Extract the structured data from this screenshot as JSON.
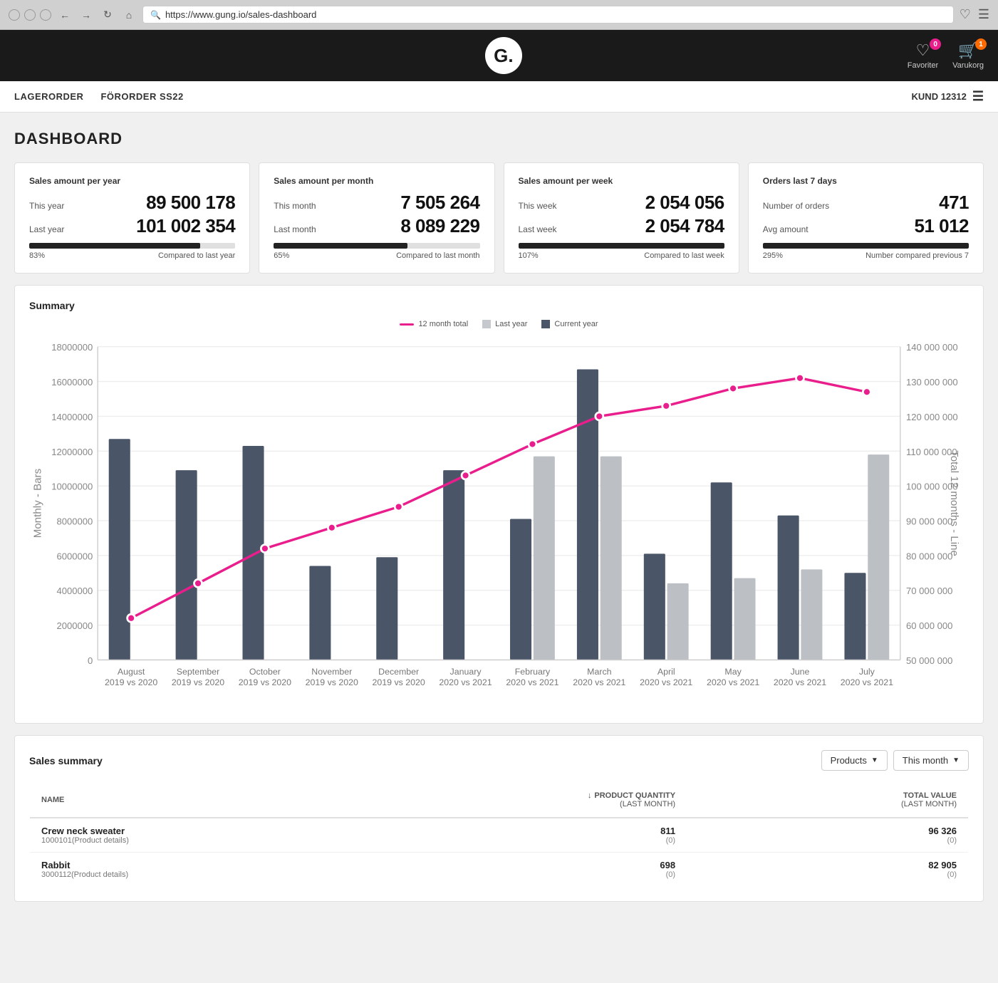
{
  "browser": {
    "url": "https://www.gung.io/sales-dashboard",
    "search_placeholder": "Search"
  },
  "header": {
    "logo_text": "G.",
    "favorites_label": "Favoriter",
    "cart_label": "Varukorg",
    "favorites_badge": "0",
    "cart_badge": "1"
  },
  "nav": {
    "items": [
      {
        "id": "lagerorder",
        "label": "LAGERORDER"
      },
      {
        "id": "fororder",
        "label": "FÖRORDER SS22"
      }
    ],
    "customer": "KUND 12312"
  },
  "page": {
    "title": "DASHBOARD"
  },
  "kpi_cards": [
    {
      "title": "Sales amount per year",
      "row1_label": "This year",
      "row1_value": "89 500 178",
      "row2_label": "Last year",
      "row2_value": "101 002 354",
      "bar_pct": 83,
      "footer_left": "83%",
      "footer_right": "Compared to last year"
    },
    {
      "title": "Sales amount per month",
      "row1_label": "This month",
      "row1_value": "7 505 264",
      "row2_label": "Last month",
      "row2_value": "8 089 229",
      "bar_pct": 65,
      "footer_left": "65%",
      "footer_right": "Compared to last month"
    },
    {
      "title": "Sales amount per week",
      "row1_label": "This week",
      "row1_value": "2 054 056",
      "row2_label": "Last week",
      "row2_value": "2 054 784",
      "bar_pct": 107,
      "footer_left": "107%",
      "footer_right": "Compared to last week"
    },
    {
      "title": "Orders last 7 days",
      "row1_label": "Number of orders",
      "row1_value": "471",
      "row2_label": "Avg amount",
      "row2_value": "51 012",
      "bar_pct": 100,
      "footer_left": "295%",
      "footer_right": "Number compared previous 7"
    }
  ],
  "chart": {
    "title": "Summary",
    "legend": {
      "line_label": "12 month total",
      "bar_light_label": "Last year",
      "bar_dark_label": "Current year"
    },
    "y_left_label": "Monthly - Bars",
    "y_right_label": "Total 12 months - Line",
    "y_left_ticks": [
      "18000000",
      "16000000",
      "14000000",
      "12000000",
      "10000000",
      "8000000",
      "6000000",
      "4000000",
      "2000000",
      "0"
    ],
    "y_right_ticks": [
      "140000000",
      "130000000",
      "120000000",
      "110000000",
      "100000000",
      "90000000",
      "80000000",
      "70000000",
      "60000000",
      "50000000"
    ],
    "months": [
      {
        "label": "August\n2019 vs 2020",
        "dark": 12700000,
        "light": 0,
        "line": 62000000
      },
      {
        "label": "September\n2019 vs 2020",
        "dark": 10900000,
        "light": 0,
        "line": 72000000
      },
      {
        "label": "October\n2019 vs 2020",
        "dark": 12300000,
        "light": 0,
        "line": 82000000
      },
      {
        "label": "November\n2019 vs 2020",
        "dark": 5400000,
        "light": 0,
        "line": 88000000
      },
      {
        "label": "December\n2019 vs 2020",
        "dark": 5900000,
        "light": 0,
        "line": 94000000
      },
      {
        "label": "January\n2020 vs 2021",
        "dark": 10900000,
        "light": 0,
        "line": 103000000
      },
      {
        "label": "February\n2020 vs 2021",
        "dark": 8100000,
        "light": 11700000,
        "line": 112000000
      },
      {
        "label": "March\n2020 vs 2021",
        "dark": 16700000,
        "light": 11700000,
        "line": 120000000
      },
      {
        "label": "April\n2020 vs 2021",
        "dark": 6100000,
        "light": 4400000,
        "line": 123000000
      },
      {
        "label": "May\n2020 vs 2021",
        "dark": 10200000,
        "light": 4700000,
        "line": 128000000
      },
      {
        "label": "June\n2020 vs 2021",
        "dark": 8300000,
        "light": 5200000,
        "line": 131000000
      },
      {
        "label": "July\n2020 vs 2021",
        "dark": 5000000,
        "light": 11800000,
        "line": 127000000
      }
    ]
  },
  "sales_summary": {
    "title": "Sales summary",
    "dropdown_products": "Products",
    "dropdown_period": "This month",
    "table": {
      "col_name": "NAME",
      "col_qty": "PRODUCT QUANTITY\n(LAST MONTH)",
      "col_val": "TOTAL VALUE\n(LAST MONTH)",
      "rows": [
        {
          "name": "Crew neck sweater",
          "id": "1000101",
          "id_link": "Product details",
          "qty": "811",
          "qty_sub": "(0)",
          "val": "96 326",
          "val_sub": "(0)"
        },
        {
          "name": "Rabbit",
          "id": "3000112",
          "id_link": "Product details",
          "qty": "698",
          "qty_sub": "(0)",
          "val": "82 905",
          "val_sub": "(0)"
        }
      ]
    }
  }
}
